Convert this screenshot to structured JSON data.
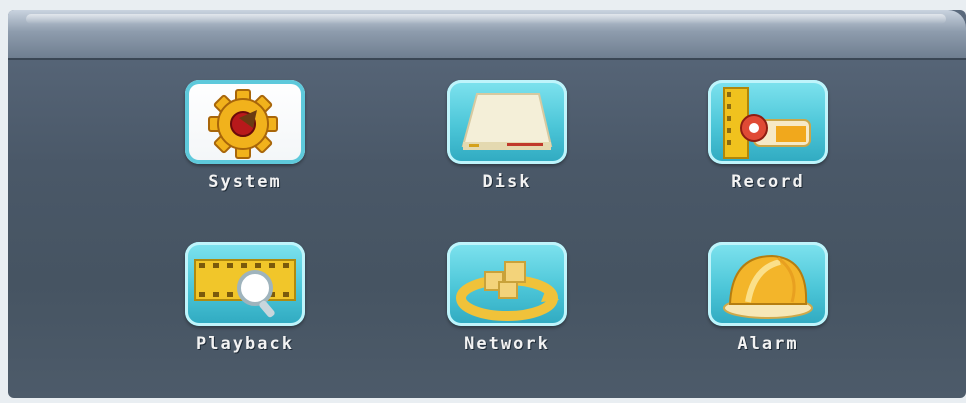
{
  "menu": {
    "items": [
      {
        "label": "System",
        "icon": "gear-icon",
        "selected": true
      },
      {
        "label": "Disk",
        "icon": "disk-icon",
        "selected": false
      },
      {
        "label": "Record",
        "icon": "record-icon",
        "selected": false
      },
      {
        "label": "Playback",
        "icon": "playback-icon",
        "selected": false
      },
      {
        "label": "Network",
        "icon": "network-icon",
        "selected": false
      },
      {
        "label": "Alarm",
        "icon": "alarm-icon",
        "selected": false
      }
    ]
  },
  "colors": {
    "icon_bg": "#4cc6d8",
    "selected_bg": "#ffffff",
    "label": "#f2f2f2",
    "panel": "#4a5868"
  }
}
